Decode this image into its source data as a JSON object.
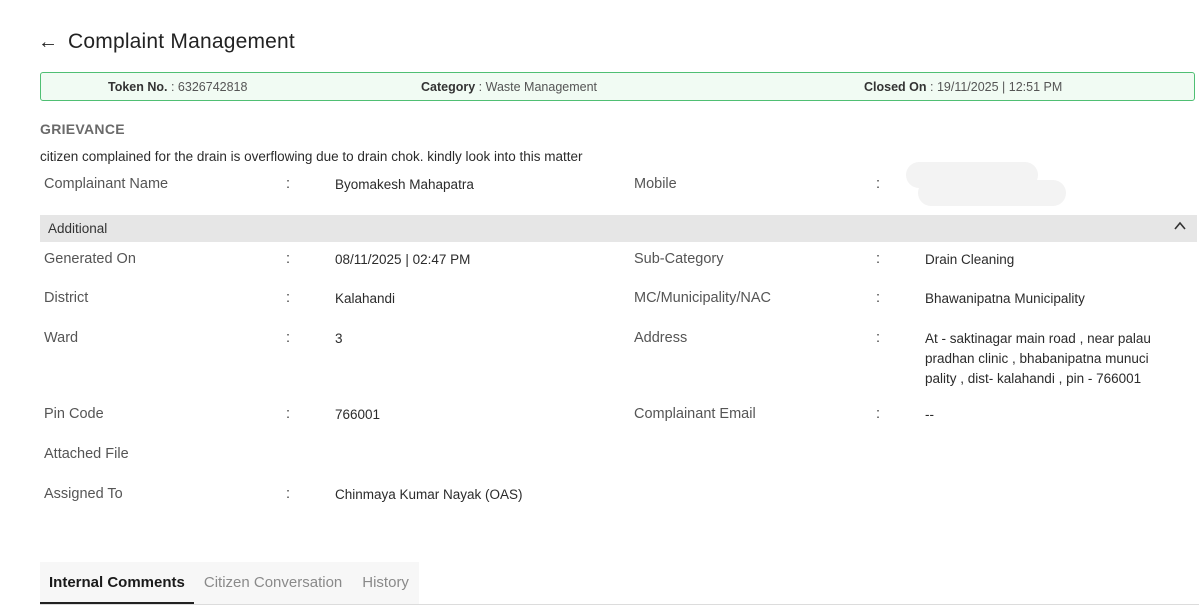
{
  "header": {
    "back_icon": "arrow-left-icon",
    "title": "Complaint Management"
  },
  "summary": {
    "token_label": "Token No.",
    "token_value": ": 6326742818",
    "category_label": "Category",
    "category_value": ": Waste Management",
    "closed_label": "Closed On",
    "closed_value": ": 19/11/2025 | 12:51 PM",
    "accent_color": "#4fbf73"
  },
  "grievance": {
    "heading": "GRIEVANCE",
    "description": "citizen complained for the drain is overflowing due to drain chok. kindly look into this matter"
  },
  "complainant": {
    "name_label": "Complainant Name",
    "name_value": "Byomakesh Mahapatra",
    "mobile_label": "Mobile"
  },
  "additional": {
    "label": "Additional",
    "toggle_icon": "chevron-up-icon",
    "generated_label": "Generated On",
    "generated_value": "08/11/2025 | 02:47 PM",
    "subcategory_label": "Sub-Category",
    "subcategory_value": "Drain Cleaning",
    "district_label": "District",
    "district_value": "Kalahandi",
    "municipality_label": "MC/Municipality/NAC",
    "municipality_value": "Bhawanipatna Municipality",
    "ward_label": "Ward",
    "ward_value": "3",
    "address_label": "Address",
    "address_value": "At - saktinagar main road , near palau pradhan clinic , bhabanipatna munuci pality , dist- kalahandi , pin - 766001",
    "pin_label": "Pin Code",
    "pin_value": "766001",
    "email_label": "Complainant Email",
    "email_value": "--",
    "attached_label": "Attached File",
    "assigned_label": "Assigned To",
    "assigned_value": "Chinmaya Kumar Nayak (OAS)"
  },
  "colon": ":",
  "tabs": [
    {
      "label": "Internal Comments",
      "active": true
    },
    {
      "label": "Citizen Conversation",
      "active": false
    },
    {
      "label": "History",
      "active": false
    }
  ]
}
